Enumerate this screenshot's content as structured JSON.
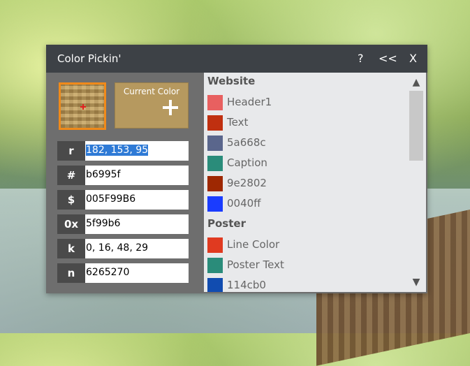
{
  "window": {
    "title": "Color Pickin'",
    "help_label": "?",
    "collapse_label": "<<",
    "close_label": "X"
  },
  "picker": {
    "sample_color": "#b6995f",
    "current_color_label": "Current Color",
    "current_color_value": "#b6995f"
  },
  "fields": [
    {
      "key": "r",
      "value": "182, 153, 95"
    },
    {
      "key": "#",
      "value": "b6995f"
    },
    {
      "key": "$",
      "value": "005F99B6"
    },
    {
      "key": "0x",
      "value": "5f99b6"
    },
    {
      "key": "k",
      "value": "0, 16, 48, 29"
    },
    {
      "key": "n",
      "value": "6265270"
    }
  ],
  "palettes": [
    {
      "name": "Website",
      "colors": [
        {
          "label": "Header1",
          "color": "#e86060"
        },
        {
          "label": "Text",
          "color": "#c03010"
        },
        {
          "label": "5a668c",
          "color": "#5a668c"
        },
        {
          "label": "Caption",
          "color": "#2a8c7a"
        },
        {
          "label": "9e2802",
          "color": "#9e2802"
        },
        {
          "label": "0040ff",
          "color": "#1a3cff"
        }
      ]
    },
    {
      "name": "Poster",
      "colors": [
        {
          "label": "Line Color",
          "color": "#e03a20"
        },
        {
          "label": "Poster Text",
          "color": "#2a8c7a"
        },
        {
          "label": "114cb0",
          "color": "#114cb0"
        }
      ]
    }
  ],
  "scrollbar": {
    "up_icon": "▲",
    "down_icon": "▼"
  }
}
